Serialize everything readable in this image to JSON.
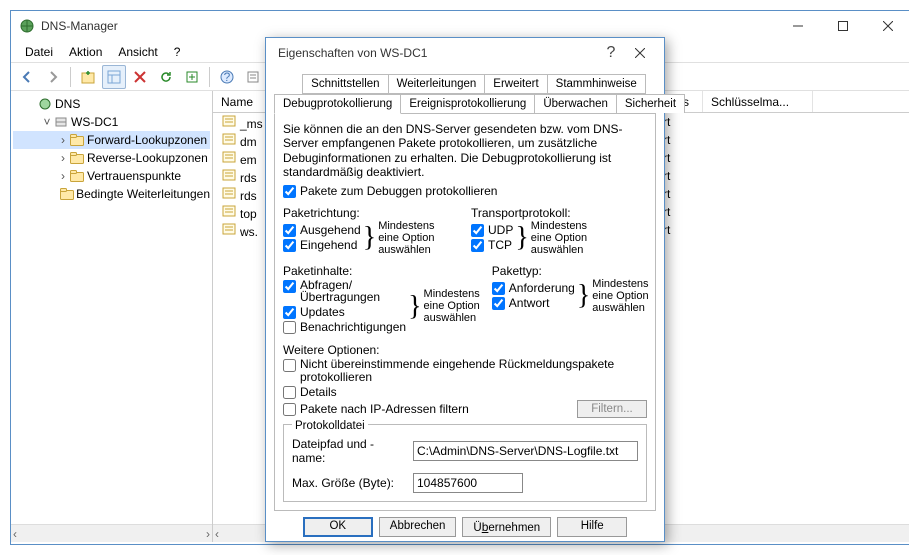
{
  "window": {
    "title": "DNS-Manager",
    "menu": [
      "Datei",
      "Aktion",
      "Ansicht",
      "?"
    ]
  },
  "tree": {
    "root": "DNS",
    "server": "WS-DC1",
    "nodes": [
      "Forward-Lookupzonen",
      "Reverse-Lookupzonen",
      "Vertrauenspunkte",
      "Bedingte Weiterleitungen"
    ]
  },
  "list": {
    "headers": {
      "name": "Name",
      "status": "",
      "dnssec": "DNSSEC-Status",
      "key": "Schlüsselma..."
    },
    "rows": [
      {
        "name": "_ms",
        "dnssec": "Nicht signiert"
      },
      {
        "name": "dm",
        "dnssec": "Nicht signiert"
      },
      {
        "name": "em",
        "dnssec": "Nicht signiert"
      },
      {
        "name": "rds",
        "dnssec": "Nicht signiert"
      },
      {
        "name": "rds",
        "dnssec": "Nicht signiert"
      },
      {
        "name": "top",
        "dnssec": "Nicht signiert"
      },
      {
        "name": "ws.",
        "dnssec": "Nicht signiert"
      }
    ]
  },
  "dialog": {
    "title": "Eigenschaften von WS-DC1",
    "tabs_top": [
      "Schnittstellen",
      "Weiterleitungen",
      "Erweitert",
      "Stammhinweise"
    ],
    "tabs_bottom": [
      "Debugprotokollierung",
      "Ereignisprotokollierung",
      "Überwachen",
      "Sicherheit"
    ],
    "intro": "Sie können die an den DNS-Server gesendeten bzw. vom DNS-Server empfangenen Pakete protokollieren, um zusätzliche Debuginformationen zu erhalten. Die Debugprotokollierung ist standardmäßig deaktiviert.",
    "enable": "Pakete zum Debuggen protokollieren",
    "direction_title": "Paketrichtung:",
    "direction": {
      "out": "Ausgehend",
      "in": "Eingehend"
    },
    "transport_title": "Transportprotokoll:",
    "transport": {
      "udp": "UDP",
      "tcp": "TCP"
    },
    "content_title": "Paketinhalte:",
    "content": {
      "q": "Abfragen/\nÜbertragungen",
      "u": "Updates",
      "n": "Benachrichtigungen"
    },
    "type_title": "Pakettyp:",
    "type": {
      "req": "Anforderung",
      "ans": "Antwort"
    },
    "hint": "Mindestens\neine Option\nauswählen",
    "more_title": "Weitere Optionen:",
    "more": {
      "unmatched": "Nicht übereinstimmende eingehende Rückmeldungspakete protokollieren",
      "details": "Details",
      "ipfilter": "Pakete nach IP-Adressen filtern"
    },
    "filter_btn": "Filtern...",
    "file_group": "Protokolldatei",
    "file_path_label": "Dateipfad und -name:",
    "file_path": "C:\\Admin\\DNS-Server\\DNS-Logfile.txt",
    "size_label": "Max. Größe (Byte):",
    "size": "104857600",
    "buttons": {
      "ok": "OK",
      "cancel": "Abbrechen",
      "apply": "Übernehmen",
      "help": "Hilfe"
    }
  }
}
